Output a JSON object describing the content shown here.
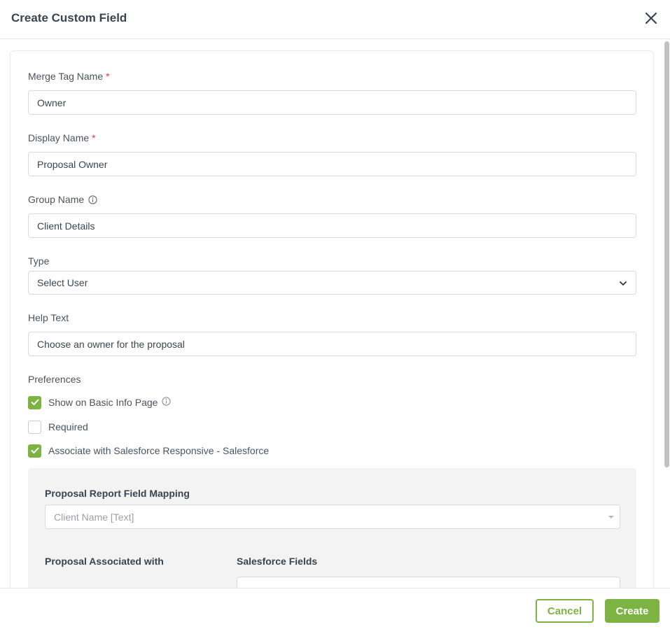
{
  "dialog": {
    "title": "Create Custom Field",
    "close_icon": "close-icon"
  },
  "form": {
    "merge_tag": {
      "label": "Merge Tag Name",
      "required_mark": "*",
      "value": "Owner"
    },
    "display_name": {
      "label": "Display Name",
      "required_mark": "*",
      "value": "Proposal Owner"
    },
    "group_name": {
      "label": "Group Name",
      "info_icon": "info-icon",
      "value": "Client Details"
    },
    "type": {
      "label": "Type",
      "value": "Select User",
      "icon": "chevron-down-icon"
    },
    "help_text": {
      "label": "Help Text",
      "value": "Choose an owner for the proposal"
    },
    "preferences": {
      "label": "Preferences",
      "options": [
        {
          "label": "Show on Basic Info Page",
          "checked": true,
          "has_info": true
        },
        {
          "label": "Required",
          "checked": false,
          "has_info": false
        },
        {
          "label": "Associate with Salesforce Responsive - Salesforce",
          "checked": true,
          "has_info": false
        }
      ]
    },
    "mapping": {
      "title": "Proposal Report Field Mapping",
      "placeholder": "Client Name [Text]",
      "col_associated": "Proposal Associated with",
      "col_salesforce": "Salesforce Fields"
    }
  },
  "footer": {
    "cancel_label": "Cancel",
    "create_label": "Create"
  },
  "colors": {
    "accent": "#7cb342",
    "required": "#e53935"
  }
}
